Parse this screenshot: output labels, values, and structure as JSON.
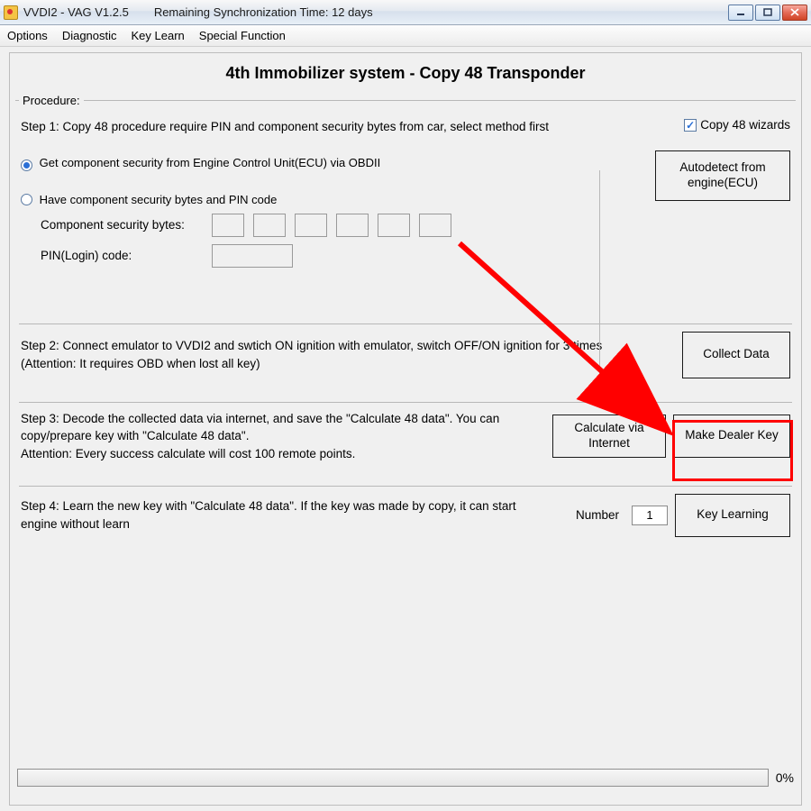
{
  "titlebar": {
    "title": "VVDI2 - VAG V1.2.5",
    "subtitle": "Remaining Synchronization Time: 12 days"
  },
  "menu": [
    "Options",
    "Diagnostic",
    "Key Learn",
    "Special Function"
  ],
  "page": {
    "title": "4th Immobilizer system - Copy 48 Transponder"
  },
  "procedure": {
    "legend": "Procedure:"
  },
  "step1": {
    "text": "Step 1: Copy 48 procedure require PIN and component security bytes from car, select method first",
    "copy48_wizards_label": "Copy 48 wizards",
    "copy48_wizards_checked": true,
    "option_a": "Get component security from Engine Control Unit(ECU) via OBDII",
    "option_b": "Have component security bytes and PIN code",
    "selected_option": "a",
    "csb_label": "Component security bytes:",
    "pin_label": "PIN(Login) code:",
    "autodetect_btn": "Autodetect from engine(ECU)"
  },
  "step2": {
    "text": "Step 2: Connect emulator to VVDI2 and swtich ON ignition with emulator, switch OFF/ON ignition for 3 times (Attention: It requires OBD when lost all key)",
    "collect_btn": "Collect Data"
  },
  "step3": {
    "text": "Step 3: Decode the collected data via internet, and save the \"Calculate 48 data\". You can copy/prepare key with \"Calculate 48 data\".\nAttention: Every success calculate will cost 100 remote points.",
    "calc_btn": "Calculate via Internet",
    "dealer_btn": "Make Dealer Key"
  },
  "step4": {
    "text": "Step 4: Learn the new key with \"Calculate 48 data\". If the key was made by copy, it can start engine without learn",
    "number_label": "Number",
    "number_value": "1",
    "learn_btn": "Key Learning"
  },
  "progress": {
    "pct": "0%"
  }
}
